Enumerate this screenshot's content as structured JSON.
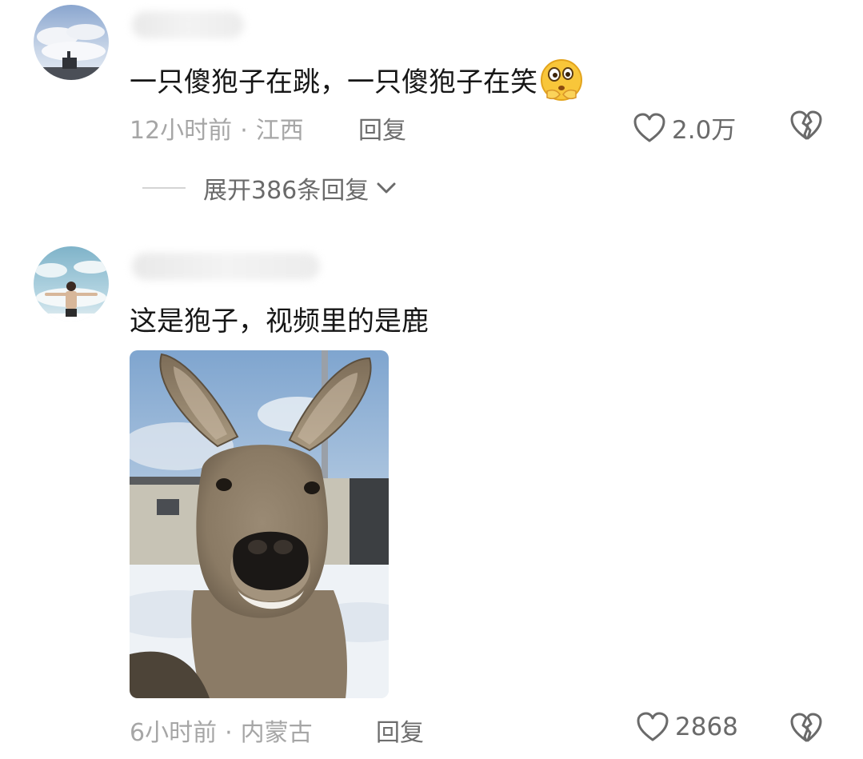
{
  "comments": [
    {
      "text": "一只傻狍子在跳，一只傻狍子在笑",
      "emoji": "thinking-face-emoji",
      "time": "12小时前",
      "separator": "·",
      "location": "江西",
      "reply_label": "回复",
      "likes": "2.0万",
      "expand_label": "展开386条回复"
    },
    {
      "text": "这是狍子，视频里的是鹿",
      "time": "6小时前",
      "separator": "·",
      "location": "内蒙古",
      "reply_label": "回复",
      "likes": "2868"
    }
  ],
  "icons": {
    "like": "heart-outline-icon",
    "dislike": "broken-heart-icon",
    "expand": "chevron-down-icon"
  },
  "colors": {
    "text": "#161616",
    "meta": "#a6a6a6",
    "action": "#6a6a6a"
  }
}
